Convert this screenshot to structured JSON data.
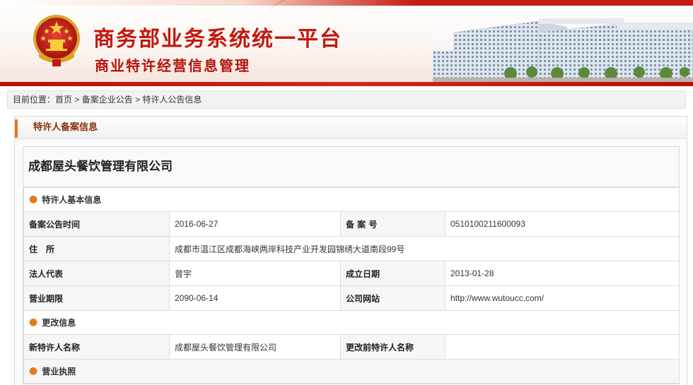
{
  "header": {
    "title_main": "商务部业务系统统一平台",
    "title_sub": "商业特许经营信息管理",
    "emblem": "national-emblem-icon",
    "buildings": "ministry-building-image"
  },
  "breadcrumb": {
    "prefix": "目前位置：",
    "items": [
      "首页",
      "备案企业公告",
      "特许人公告信息"
    ],
    "separator": " > "
  },
  "panel": {
    "title": "特许人备案信息",
    "accent_color": "#e8761b"
  },
  "company": {
    "name": "成都屋头餐饮管理有限公司"
  },
  "sections": {
    "basic": "特许人基本信息",
    "change": "更改信息",
    "license": "营业执照"
  },
  "basic_info": {
    "filing_date_label": "备案公告时间",
    "filing_date": "2016-06-27",
    "filing_no_label": "备 案 号",
    "filing_no": "0510100211600093",
    "address_label": "住　所",
    "address": "成都市温江区成都海峡两岸科技产业开发园锦绣大道南段99号",
    "legal_rep_label": "法人代表",
    "legal_rep": "曾宇",
    "established_label": "成立日期",
    "established": "2013-01-28",
    "term_label": "营业期限",
    "term": "2090-06-14",
    "website_label": "公司网站",
    "website": "http://www.wutoucc.com/"
  },
  "change_info": {
    "new_name_label": "新特许人名称",
    "new_name": "成都屋头餐饮管理有限公司",
    "old_name_label": "更改前特许人名称",
    "old_name": ""
  },
  "colors": {
    "brand_red": "#c4170d",
    "section_dot": "#e67817"
  }
}
